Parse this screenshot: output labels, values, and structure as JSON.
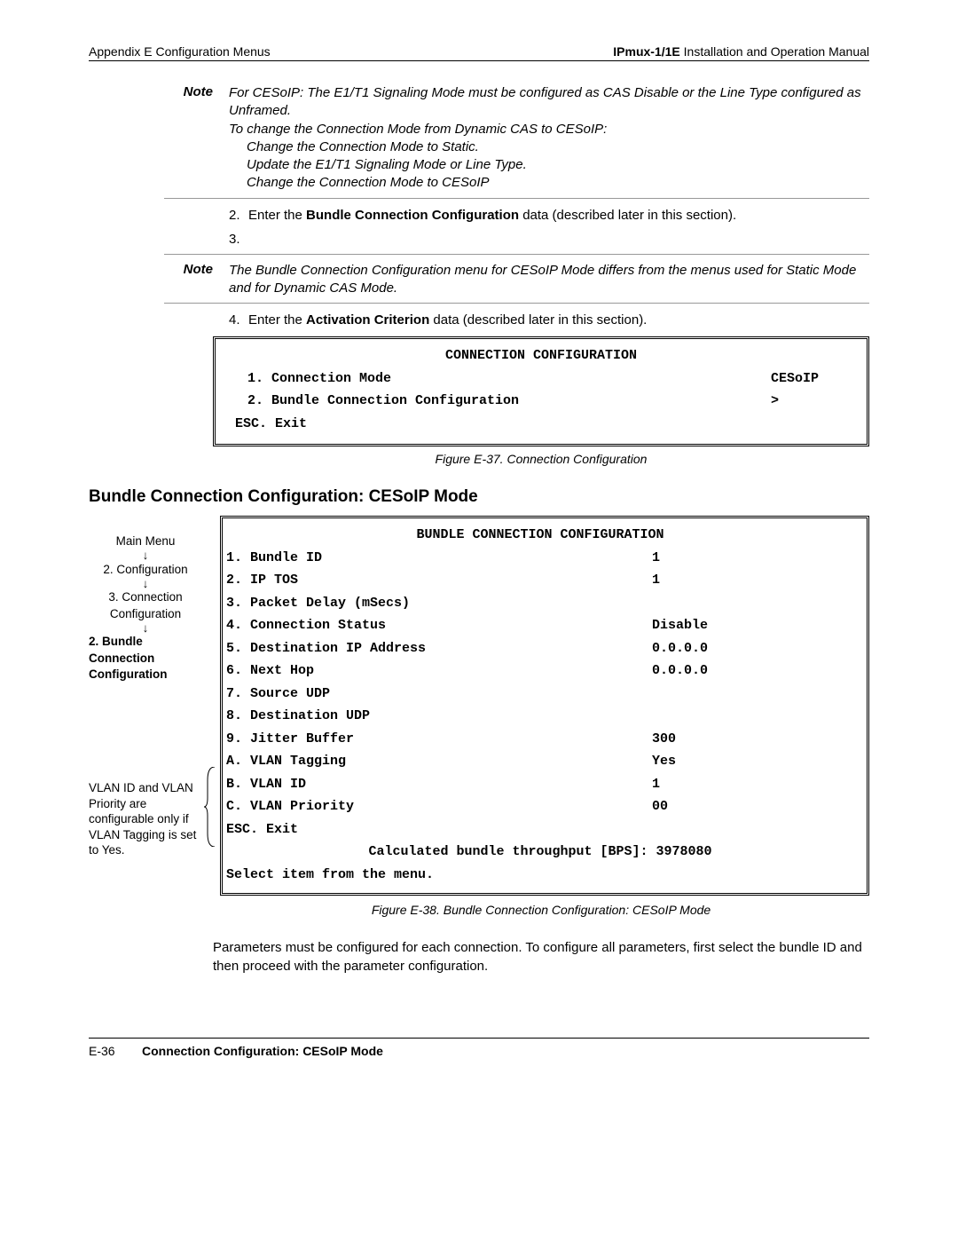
{
  "header": {
    "left": "Appendix E  Configuration Menus",
    "right_bold": "IPmux-1/1E",
    "right_rest": " Installation and Operation Manual"
  },
  "note1": {
    "label": "Note",
    "line1": "For CESoIP: The E1/T1 Signaling Mode must be configured as CAS Disable or the Line Type configured as Unframed.",
    "line2": "To change the Connection Mode from Dynamic CAS to CESoIP:",
    "indent1": "Change the Connection Mode to Static.",
    "indent2": "Update the E1/T1 Signaling Mode or Line Type.",
    "indent3": "Change the Connection Mode to CESoIP"
  },
  "step2": {
    "num": "2.",
    "pre": "Enter the ",
    "bold": "Bundle Connection Configuration",
    "post": " data (described later in this section)."
  },
  "step3": {
    "num": "3."
  },
  "note2": {
    "label": "Note",
    "text": "The Bundle Connection Configuration menu for CESoIP Mode differs from the menus used for Static Mode and for Dynamic CAS Mode."
  },
  "step4": {
    "num": "4.",
    "pre": "Enter the ",
    "bold": "Activation Criterion",
    "post": " data (described later in this section)."
  },
  "term1": {
    "title": "CONNECTION CONFIGURATION",
    "row1_label": "1. Connection Mode",
    "row1_value": "CESoIP",
    "row2_label": "2. Bundle Connection Configuration",
    "row2_value": ">",
    "esc": "ESC. Exit"
  },
  "fig1": "Figure E-37.  Connection Configuration",
  "section_h": "Bundle Connection Configuration: CESoIP Mode",
  "nav": {
    "n1": "Main Menu",
    "n2": "2. Configuration",
    "n3a": "3. Connection",
    "n3b": "Configuration",
    "n4a": "2. Bundle",
    "n4b": "Connection",
    "n4c": "Configuration",
    "arrow": "↓"
  },
  "side_note": "VLAN ID and VLAN Priority are configurable only if VLAN Tagging is set to Yes.",
  "term2": {
    "title": "BUNDLE CONNECTION CONFIGURATION",
    "rows": [
      {
        "l": "1. Bundle ID",
        "v": "1"
      },
      {
        "l": "2. IP TOS",
        "v": "1"
      },
      {
        "l": "3. Packet Delay (mSecs)",
        "v": ""
      },
      {
        "l": "4. Connection Status",
        "v": "Disable"
      },
      {
        "l": "5. Destination IP Address",
        "v": "0.0.0.0"
      },
      {
        "l": "6. Next Hop",
        "v": "0.0.0.0"
      },
      {
        "l": "7. Source UDP",
        "v": ""
      },
      {
        "l": "8. Destination UDP",
        "v": ""
      },
      {
        "l": "9. Jitter Buffer",
        "v": "300"
      },
      {
        "l": "A. VLAN Tagging",
        "v": "Yes"
      },
      {
        "l": "B. VLAN ID",
        "v": "1"
      },
      {
        "l": "C. VLAN Priority",
        "v": "00"
      }
    ],
    "esc": "ESC. Exit",
    "calc": "Calculated bundle throughput [BPS]: 3978080",
    "select": "Select item from the menu."
  },
  "fig2": "Figure E-38.  Bundle Connection Configuration: CESoIP Mode",
  "body_para": "Parameters must be configured for each connection. To configure all parameters, first select the bundle ID and then proceed with the parameter configuration.",
  "footer": {
    "page": "E-36",
    "title": "Connection Configuration: CESoIP Mode"
  }
}
